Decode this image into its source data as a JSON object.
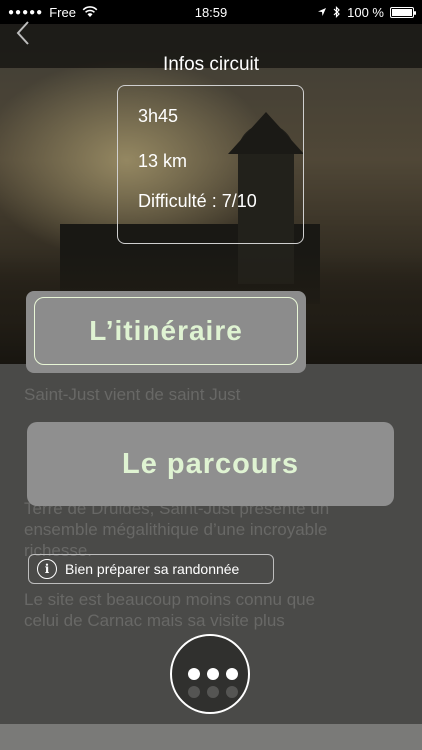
{
  "status": {
    "carrier": "Free",
    "time": "18:59",
    "battery": "100 %"
  },
  "info": {
    "title": "Infos circuit",
    "duration": "3h45",
    "distance": "13 km",
    "difficulty": "Difficulté : 7/10"
  },
  "buttons": {
    "itineraire": "L’itinéraire",
    "parcours": "Le parcours",
    "prep": "Bien préparer sa randonnée"
  },
  "text": {
    "line1": "Saint-Just vient de saint Just",
    "line2": "Terre de Druides, Saint-Just présente un",
    "line3": "ensemble mégalithique d’une incroyable",
    "line4": "richesse.",
    "line5": "Le site est beaucoup moins connu que",
    "line6": "celui de Carnac mais sa visite plus"
  },
  "icons": {
    "wifi": "wifi-icon",
    "location": "location-arrow-icon",
    "bluetooth": "bluetooth-icon",
    "battery": "battery-icon",
    "back": "chevron-left-icon",
    "info": "info-icon",
    "more": "more-dots-icon"
  },
  "colors": {
    "button_text": "#dff3d2",
    "button_bg": "#8f8f8f"
  }
}
